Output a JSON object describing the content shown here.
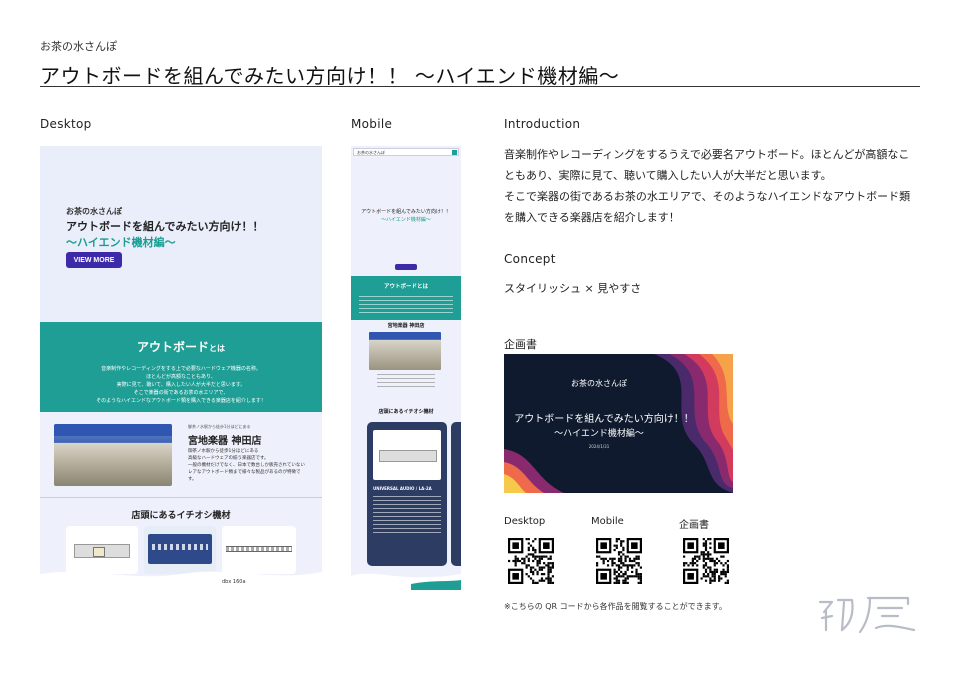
{
  "header": {
    "site_name": "お茶の水さんぽ",
    "title": "アウトボードを組んでみたい方向け！！ 〜ハイエンド機材編〜"
  },
  "sections": {
    "desktop_label": "Desktop",
    "mobile_label": "Mobile",
    "introduction_label": "Introduction",
    "concept_label": "Concept",
    "proposal_label": "企画書"
  },
  "introduction": {
    "lines": [
      "音楽制作やレコーディングをするうえで必要名アウトボード。ほとんどが高額なこ",
      "ともあり、実際に見て、聴いて購入したい人が大半だと思います。",
      "そこで楽器の街であるお茶の水エリアで、そのようなハイエンドなアウトボード類",
      "を購入できる楽器店を紹介します！"
    ]
  },
  "concept": {
    "text": "スタイリッシュ × 見やすさ"
  },
  "desktop_mock": {
    "hero_site": "お茶の水さんぽ",
    "hero_title_1": "アウトボードを組んでみたい方向け！！",
    "hero_title_2": "〜ハイエンド機材編〜",
    "cta_label": "VIEW MORE",
    "about_heading": "アウトボード",
    "about_heading_suffix": "とは",
    "about_lines": [
      "音楽制作やレコーディングをする上で必要なハードウェア機器の名称。",
      "ほとんどが高額なこともあり、",
      "実際に見て、聴いて、購入したい人が大半だと思います。",
      "そこで楽器の街であるお茶の水エリアで、",
      "そのようなハイエンドなアウトボード類を購入できる楽器店を紹介します！"
    ],
    "store_caption": "御茶ノ水駅から徒歩1分ほどにある",
    "store_name": "宮地楽器 神田店",
    "store_lines": [
      "御茶ノ水駅から徒歩1分ほどにある",
      "高級なハードウェアの揃う楽器店です。",
      "一般の機材だけでなく、日本で数台しか販売されていない",
      "レアなアウトボード類まで様々な製品があるのが特徴です。"
    ],
    "pick_heading": "店頭にあるイチオシ機材",
    "below_product": "dbx 160a"
  },
  "mobile_mock": {
    "bar_title": "お茶の水さんぽ",
    "hero_title_1": "アウトボードを組んでみたい方向け！！",
    "hero_title_2": "〜ハイエンド機材編〜",
    "about_heading": "アウトボードとは",
    "store_heading": "宮地楽器 神田店",
    "pick_heading": "店頭にあるイチオシ機材",
    "product_name": "UNIVERSAL AUDIO / LA-2A"
  },
  "proposal": {
    "site": "お茶の水さんぽ",
    "title_1": "アウトボードを組んでみたい方向け！！",
    "title_2": "〜ハイエンド機材編〜",
    "date": "2024/1/31"
  },
  "qr_codes": [
    {
      "label": "Desktop"
    },
    {
      "label": "Mobile"
    },
    {
      "label": "企画書"
    }
  ],
  "note": "※こちらの QR コードから各作品を閲覧することができます。",
  "logo_text": "初展",
  "colors": {
    "teal": "#1e9e95",
    "purple": "#3d2aa8",
    "navy": "#0f1a2e",
    "mock_bg": "#eef1fb"
  }
}
